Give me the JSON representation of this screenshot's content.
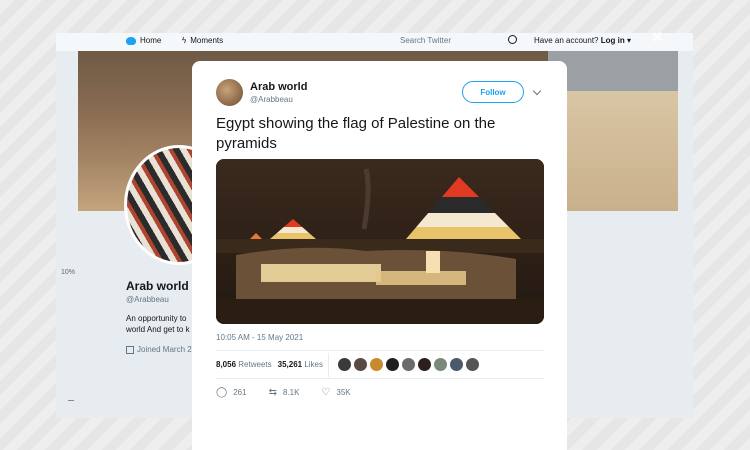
{
  "topbar": {
    "home_label": "Home",
    "moments_label": "Moments",
    "search_placeholder": "Search Twitter",
    "account_prompt": "Have an account?",
    "login_label": "Log in"
  },
  "page": {
    "zoom_label": "10%"
  },
  "profile": {
    "name": "Arab world",
    "handle": "@Arabbeau",
    "bio_line1": "An opportunity to",
    "bio_line2": "world And get to k",
    "joined": "Joined March 2"
  },
  "modal": {
    "close_label": "×"
  },
  "tweet": {
    "author_name": "Arab world",
    "author_handle": "@Arabbeau",
    "follow_label": "Follow",
    "text": "Egypt showing the flag of Palestine on the pyramids",
    "timestamp": "10:05 AM - 15 May 2021",
    "retweets_count": "8,056",
    "retweets_label": "Retweets",
    "likes_count": "35,261",
    "likes_label": "Likes",
    "replies": "261",
    "retweet_action": "8.1K",
    "like_action": "35K",
    "liker_colors": [
      "#3a3a3a",
      "#5a4a44",
      "#c98a2e",
      "#1f1f1f",
      "#6b6b6b",
      "#2c1f1f",
      "#7a8a7a",
      "#4a5a6a",
      "#555555"
    ]
  },
  "colors": {
    "accent": "#1da1f2",
    "flag_red": "#e23a22",
    "flag_white": "#f4e8d0",
    "flag_green": "#3c8a3a"
  }
}
